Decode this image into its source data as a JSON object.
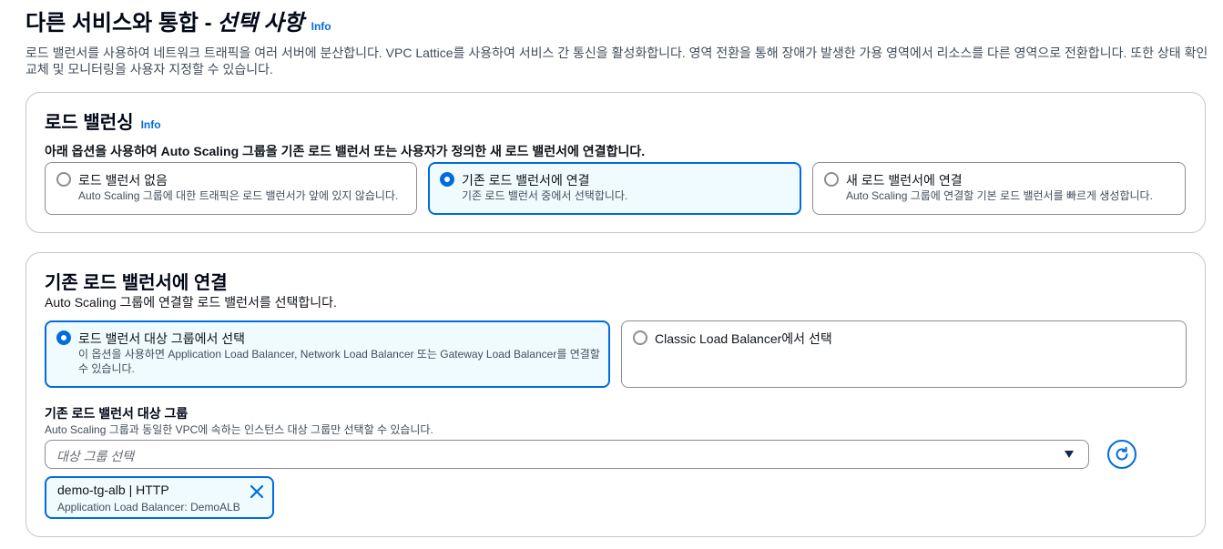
{
  "header": {
    "title_main": "다른 서비스와 통합 -",
    "title_italic": "선택 사항",
    "info": "Info",
    "description": "로드 밸런서를 사용하여 네트워크 트래픽을 여러 서버에 분산합니다. VPC Lattice를 사용하여 서비스 간 통신을 활성화합니다. 영역 전환을 통해 장애가 발생한 가용 영역에서 리소스를 다른 영역으로 전환합니다. 또한 상태 확인 교체 및 모니터링을 사용자 지정할 수 있습니다."
  },
  "load_balancing": {
    "title": "로드 밸런싱",
    "info": "Info",
    "description": "아래 옵션을 사용하여 Auto Scaling 그룹을 기존 로드 밸런서 또는 사용자가 정의한 새 로드 밸런서에 연결합니다.",
    "options": [
      {
        "label": "로드 밸런서 없음",
        "desc": "Auto Scaling 그룹에 대한 트래픽은 로드 밸런서가 앞에 있지 않습니다.",
        "selected": false
      },
      {
        "label": "기존 로드 밸런서에 연결",
        "desc": "기존 로드 밸런서 중에서 선택합니다.",
        "selected": true
      },
      {
        "label": "새 로드 밸런서에 연결",
        "desc": "Auto Scaling 그룹에 연결할 기본 로드 밸런서를 빠르게 생성합니다.",
        "selected": false
      }
    ]
  },
  "attach_existing": {
    "title": "기존 로드 밸런서에 연결",
    "description": "Auto Scaling 그룹에 연결할 로드 밸런서를 선택합니다.",
    "options": [
      {
        "label": "로드 밸런서 대상 그룹에서 선택",
        "desc": "이 옵션을 사용하면 Application Load Balancer, Network Load Balancer 또는 Gateway Load Balancer를 연결할 수 있습니다.",
        "selected": true
      },
      {
        "label": "Classic Load Balancer에서 선택",
        "desc": "",
        "selected": false
      }
    ],
    "target_group": {
      "label": "기존 로드 밸런서 대상 그룹",
      "description": "Auto Scaling 그룹과 동일한 VPC에 속하는 인스턴스 대상 그룹만 선택할 수 있습니다.",
      "placeholder": "대상 그룹 선택",
      "selected_token": {
        "title": "demo-tg-alb | HTTP",
        "subtitle": "Application Load Balancer: DemoALB"
      }
    }
  },
  "icons": {
    "refresh": "refresh-icon",
    "dropdown": "caret-down-icon",
    "dismiss": "close-icon"
  },
  "colors": {
    "accent": "#006ce0",
    "selected_bg": "#f0fbff",
    "border": "#8c8c94"
  }
}
